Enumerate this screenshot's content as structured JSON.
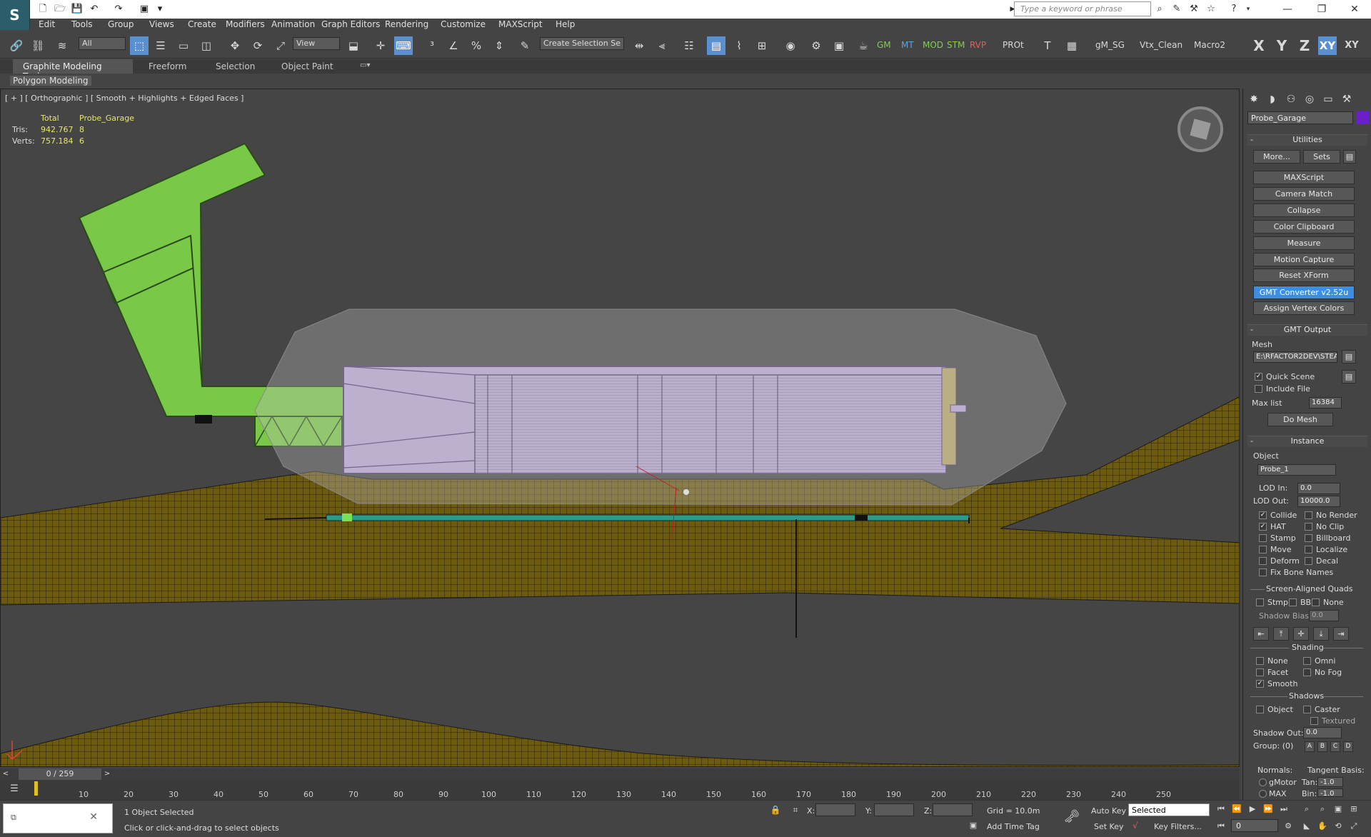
{
  "titlebar": {
    "logo": "S",
    "search_placeholder": "Type a keyword or phrase",
    "min": "—",
    "max": "❐",
    "close": "✕"
  },
  "menu": [
    "Edit",
    "Tools",
    "Group",
    "Views",
    "Create",
    "Modifiers",
    "Animation",
    "Graph Editors",
    "Rendering",
    "Customize",
    "MAXScript",
    "Help"
  ],
  "toolbar": {
    "filter_value": "All",
    "refcoord_value": "View",
    "selection_set_value": "Create Selection Se",
    "text_buttons": [
      "GM",
      "MT",
      "MOD",
      "STM",
      "RVP",
      "PROt",
      "gM_SG",
      "Vtx_Clean",
      "Macro2"
    ],
    "axis_buttons": [
      "X",
      "Y",
      "Z",
      "XY",
      "XY"
    ]
  },
  "ribbon": {
    "tabs": [
      "Graphite Modeling Tools",
      "Freeform",
      "Selection",
      "Object Paint"
    ],
    "panel_label": "Polygon Modeling"
  },
  "viewport": {
    "label": "[ + ] [ Orthographic ] [ Smooth + Highlights + Edged Faces ]",
    "stats": {
      "header_total": "Total",
      "header_object": "Probe_Garage",
      "tris_label": "Tris:",
      "tris_total": "942.767",
      "tris_object": "8",
      "verts_label": "Verts:",
      "verts_total": "757.184",
      "verts_object": "6"
    }
  },
  "panel": {
    "object_name": "Probe_Garage",
    "object_color": "#6a1fc8",
    "utilities_title": "Utilities",
    "more_label": "More...",
    "sets_label": "Sets",
    "utilities": [
      "MAXScript",
      "Camera Match",
      "Collapse",
      "Color Clipboard",
      "Measure",
      "Motion Capture",
      "Reset XForm",
      "GMT Converter v2.52u",
      "Assign Vertex Colors"
    ],
    "gmt_output_title": "GMT Output",
    "mesh_label": "Mesh",
    "mesh_path": "E:\\RFACTOR2DEV\\STEA",
    "quick_scene": "Quick Scene",
    "include_file": "Include File",
    "max_list_label": "Max list",
    "max_list_value": "16384",
    "do_mesh": "Do Mesh",
    "instance_title": "Instance",
    "object_label": "Object",
    "instance_name": "Probe_1",
    "lod_in_label": "LOD In:",
    "lod_in_value": "0.0",
    "lod_out_label": "LOD Out:",
    "lod_out_value": "10000.0",
    "flags_left": [
      "Collide",
      "HAT",
      "Stamp",
      "Move",
      "Deform",
      "Fix Bone Names"
    ],
    "flags_right": [
      "No Render",
      "No Clip",
      "Billboard",
      "Localize",
      "Decal"
    ],
    "saq_title": "Screen-Aligned Quads",
    "saq_opts": [
      "Stmp",
      "BB",
      "None"
    ],
    "shadow_bias_label": "Shadow Bias:",
    "shadow_bias_value": "0.0",
    "shading_title": "Shading",
    "shading_left": [
      "None",
      "Facet",
      "Smooth"
    ],
    "shading_right": [
      "Omni",
      "No Fog"
    ],
    "shadows_title": "Shadows",
    "shadows_opts": [
      "Object",
      "Caster",
      "Textured"
    ],
    "shadow_out_label": "Shadow Out:",
    "shadow_out_value": "0.0",
    "group_label": "Group: (0)",
    "group_btns": [
      "A",
      "B",
      "C",
      "D"
    ],
    "normals_label": "Normals:",
    "tangent_label": "Tangent Basis:",
    "gmotor_label": "gMotor",
    "tan_label": "Tan:",
    "tan_value": "-1.0",
    "max_label": "MAX",
    "bin_label": "Bin:",
    "bin_value": "-1.0"
  },
  "timeline": {
    "slider": "0 / 259",
    "ticks": [
      "10",
      "20",
      "30",
      "40",
      "50",
      "60",
      "70",
      "80",
      "90",
      "100",
      "110",
      "120",
      "130",
      "140",
      "150",
      "160",
      "170",
      "180",
      "190",
      "200",
      "210",
      "220",
      "230",
      "240",
      "250"
    ]
  },
  "status": {
    "selected_text": "1 Object Selected",
    "prompt": "Click or click-and-drag to select objects",
    "x_label": "X:",
    "y_label": "Y:",
    "z_label": "Z:",
    "grid": "Grid = 10.0m",
    "auto_key": "Auto Key",
    "set_key": "Set Key",
    "selected_value": "Selected",
    "key_filters": "Key Filters...",
    "add_time_tag": "Add Time Tag",
    "frame_value": "0"
  }
}
